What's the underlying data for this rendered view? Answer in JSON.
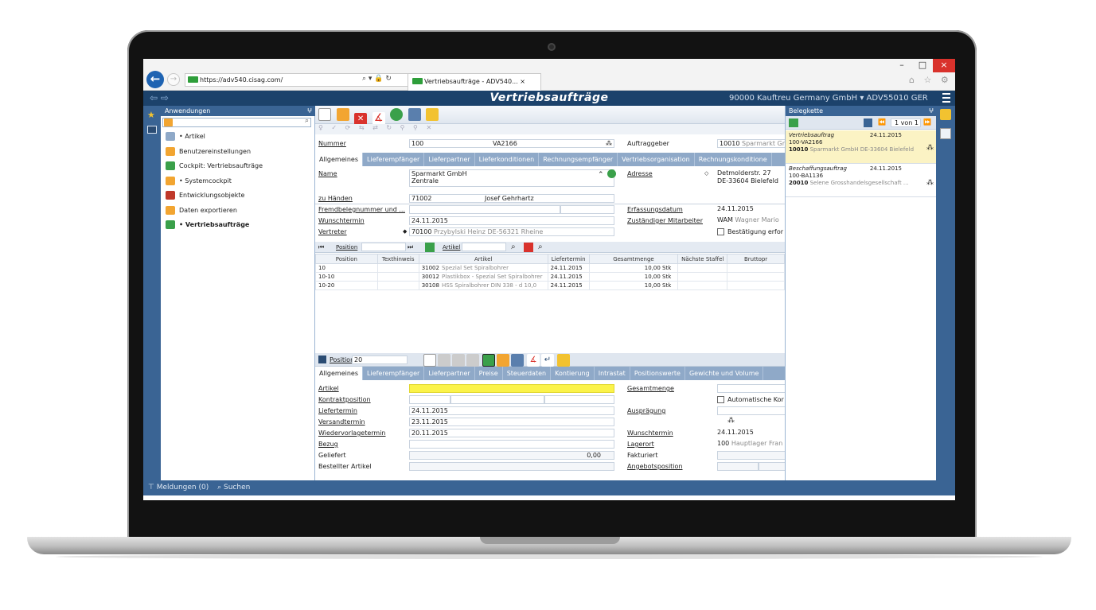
{
  "browser": {
    "url": "https://adv540.cisag.com/",
    "url_controls": "⌕ ▾ 🔒 ↻",
    "tab_title": "Vertriebsaufträge - ADV540... ×",
    "icons": "⌂ ☆ ⚙",
    "window_min": "–",
    "window_max": "□",
    "window_close": "×"
  },
  "app": {
    "title": "Vertriebsaufträge",
    "company": "90000  Kauftreu Germany GmbH ▾  ADV55010  GER"
  },
  "sidebar": {
    "header": "Anwendungen",
    "pin": "ⵖ",
    "items": [
      {
        "label": "• Artikel",
        "icon_color": "#8fa9c8",
        "bold": false
      },
      {
        "label": "Benutzereinstellungen",
        "icon_color": "#f2a531",
        "bold": false
      },
      {
        "label": "Cockpit: Vertriebsaufträge",
        "icon_color": "#3aa04a",
        "bold": false
      },
      {
        "label": "• Systemcockpit",
        "icon_color": "#f2a531",
        "bold": false
      },
      {
        "label": "Entwicklungsobjekte",
        "icon_color": "#c0392b",
        "bold": false
      },
      {
        "label": "Daten exportieren",
        "icon_color": "#f2a531",
        "bold": false
      },
      {
        "label": "• Vertriebsaufträge",
        "icon_color": "#3aa04a",
        "bold": true
      }
    ]
  },
  "bottom": {
    "messages": "Meldungen (0)",
    "search": "Suchen"
  },
  "header_fields": {
    "nummer_label": "Nummer",
    "nummer": "100",
    "order_code": "VA2166",
    "auftraggeber_label": "Auftraggeber",
    "auftraggeber_num": "10010",
    "auftraggeber_name": "Sparmarkt Gr"
  },
  "tabs_top": [
    "Allgemeines",
    "Lieferempfänger",
    "Lieferpartner",
    "Lieferkonditionen",
    "Rechnungsempfänger",
    "Vertriebsorganisation",
    "Rechnungskonditione"
  ],
  "general": {
    "name_label": "Name",
    "name_line1": "Sparmarkt GmbH",
    "name_line2": "Zentrale",
    "adresse_label": "Adresse",
    "adresse_line1": "Detmolderstr. 27",
    "adresse_line2": "DE-33604 Bielefeld",
    "zuhaenden_label": "zu Händen",
    "zuhaenden_num": "71002",
    "zuhaenden_name": "Josef Gehrhartz",
    "fremd_label": "Fremdbelegnummer und ...",
    "erfassung_label": "Erfassungsdatum",
    "erfassung": "24.11.2015",
    "wunsch_label": "Wunschtermin",
    "wunsch": "24.11.2015",
    "zust_label": "Zuständiger Mitarbeiter",
    "zust_code": "WAM",
    "zust_name": "Wagner Mario",
    "vertreter_label": "Vertreter",
    "vertreter_num": "70100",
    "vertreter_name": "Przybylski Heinz DE-56321 Rheine",
    "bestaetigung_label": "Bestätigung erfor"
  },
  "position_bar": {
    "position_label": "Position",
    "artikel_label": "Artikel"
  },
  "positions": {
    "headers": [
      "Position",
      "Texthinweis",
      "Artikel",
      "Liefertermin",
      "Gesamtmenge",
      "Nächste Staffel",
      "Bruttopr"
    ],
    "rows": [
      {
        "pos": "10",
        "text": "",
        "art_num": "31002",
        "art_name": "Spezial Set Spiralbohrer",
        "date": "24.11.2015",
        "qty": "10,00 Stk",
        "staffel": "",
        "brutto": ""
      },
      {
        "pos": "10-10",
        "text": "",
        "art_num": "30012",
        "art_name": "Plastikbox - Spezial Set Spiralbohrer",
        "date": "24.11.2015",
        "qty": "10,00 Stk",
        "staffel": "",
        "brutto": ""
      },
      {
        "pos": "10-20",
        "text": "",
        "art_num": "30108",
        "art_name": "HSS Spiralbohrer DIN 338 - d 10,0",
        "date": "24.11.2015",
        "qty": "10,00 Stk",
        "staffel": "",
        "brutto": ""
      }
    ]
  },
  "position_detail": {
    "label": "Position",
    "value": "20"
  },
  "tabs_bottom": [
    "Allgemeines",
    "Lieferempfänger",
    "Lieferpartner",
    "Preise",
    "Steuerdaten",
    "Kontierung",
    "Intrastat",
    "Positionswerte",
    "Gewichte und Volume"
  ],
  "detail": {
    "artikel_label": "Artikel",
    "kontrakt_label": "Kontraktposition",
    "liefer_label": "Liefertermin",
    "liefer": "24.11.2015",
    "versand_label": "Versandtermin",
    "versand": "23.11.2015",
    "wieder_label": "Wiedervorlagetermin",
    "wieder": "20.11.2015",
    "bezug_label": "Bezug",
    "geliefert_label": "Geliefert",
    "geliefert": "0,00",
    "bestellt_label": "Bestellter Artikel",
    "gesamt_label": "Gesamtmenge",
    "auto_label": "Automatische Kor",
    "auspraegung_label": "Ausprägung",
    "wunsch_label": "Wunschtermin",
    "wunsch": "24.11.2015",
    "lagerort_label": "Lagerort",
    "lagerort_num": "100",
    "lagerort_name": "Hauptlager Fran",
    "fakturiert_label": "Fakturiert",
    "angebot_label": "Angebotsposition"
  },
  "belegkette": {
    "header": "Belegkette",
    "pager": "1 von 1",
    "items": [
      {
        "type": "Vertriebsauftrag",
        "date": "24.11.2015",
        "code": "100-VA2166",
        "num": "10010",
        "desc": "Sparmarkt GmbH DE-33604 Bielefeld",
        "selected": true
      },
      {
        "type": "Beschaffungsauftrag",
        "date": "24.11.2015",
        "code": "100-BA1136",
        "num": "20010",
        "desc": "Selene Grosshandelsgesellschaft ...",
        "selected": false
      }
    ]
  }
}
